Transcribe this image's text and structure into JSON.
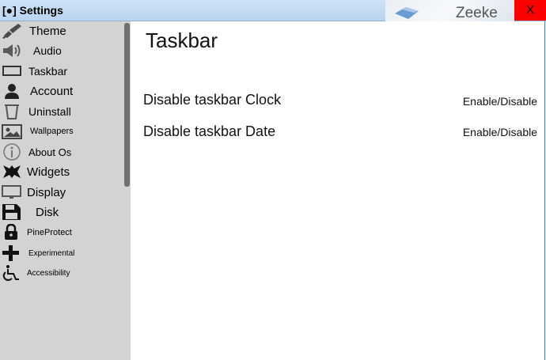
{
  "window": {
    "title": "[●] Settings",
    "close_label": "X",
    "background_text": "Zeeke"
  },
  "sidebar": {
    "items": [
      {
        "label": "Theme",
        "icon": "brush-icon"
      },
      {
        "label": "Audio",
        "icon": "speaker-icon"
      },
      {
        "label": "Taskbar",
        "icon": "taskbar-icon"
      },
      {
        "label": "Account",
        "icon": "user-icon"
      },
      {
        "label": "Uninstall",
        "icon": "trash-icon"
      },
      {
        "label": "Wallpapers",
        "icon": "image-icon"
      },
      {
        "label": "About Os",
        "icon": "info-icon"
      },
      {
        "label": "Widgets",
        "icon": "puzzle-icon"
      },
      {
        "label": "Display",
        "icon": "monitor-icon"
      },
      {
        "label": "Disk",
        "icon": "floppy-icon"
      },
      {
        "label": "PineProtect",
        "icon": "lock-icon"
      },
      {
        "label": "Experimental",
        "icon": "plus-icon"
      },
      {
        "label": "Accessibility",
        "icon": "accessibility-icon"
      }
    ]
  },
  "main": {
    "title": "Taskbar",
    "settings": [
      {
        "label": "Disable taskbar Clock",
        "toggle": "Enable/Disable"
      },
      {
        "label": "Disable taskbar Date",
        "toggle": "Enable/Disable"
      }
    ]
  },
  "colors": {
    "titlebar": "#c4dbf2",
    "sidebar": "#d3d3d3",
    "close": "#ff0000",
    "scrollbar": "#6f6f6f"
  }
}
